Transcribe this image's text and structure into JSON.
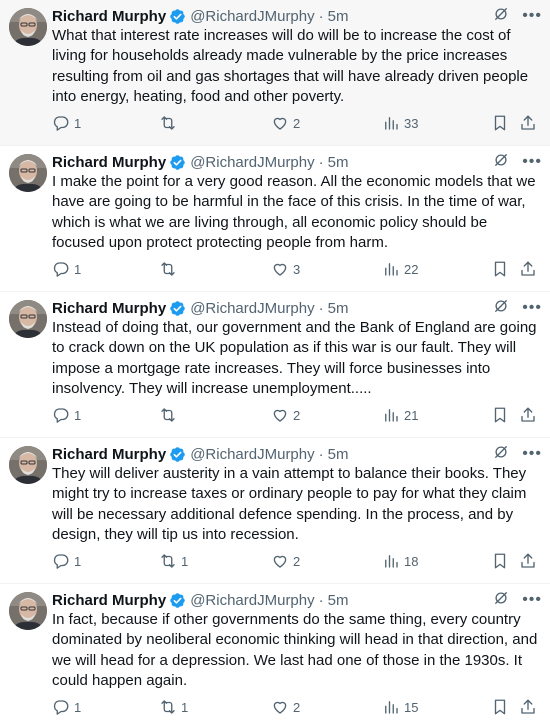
{
  "tweets": [
    {
      "name": "Richard Murphy",
      "handle": "@RichardJMurphy",
      "sep": "·",
      "time": "5m",
      "text": "What that interest rate increases will do will be to increase the cost of living for households already made vulnerable by the price increases resulting from oil and gas shortages that will have already driven people into energy, heating, food and other poverty.",
      "replies": "1",
      "retweets": "",
      "likes": "2",
      "views": "33"
    },
    {
      "name": "Richard Murphy",
      "handle": "@RichardJMurphy",
      "sep": "·",
      "time": "5m",
      "text": "I make the point for a very good reason. All the economic models that we have are going to be harmful in the face of this crisis. In the time of war, which is what we are living through, all economic policy should be focused upon protect protecting people from harm.",
      "replies": "1",
      "retweets": "",
      "likes": "3",
      "views": "22"
    },
    {
      "name": "Richard Murphy",
      "handle": "@RichardJMurphy",
      "sep": "·",
      "time": "5m",
      "text": "Instead of doing that, our government and the Bank of England are going to crack down on the UK population as if this war is our fault. They will impose a mortgage rate increases. They will force businesses into insolvency. They will increase unemployment.....",
      "replies": "1",
      "retweets": "",
      "likes": "2",
      "views": "21"
    },
    {
      "name": "Richard Murphy",
      "handle": "@RichardJMurphy",
      "sep": "·",
      "time": "5m",
      "text": "They will deliver austerity in a vain attempt to balance their books. They might try to increase taxes or ordinary people to pay for what they claim will be necessary additional defence spending. In the process, and by design, they will tip us into recession.",
      "replies": "1",
      "retweets": "1",
      "likes": "2",
      "views": "18"
    },
    {
      "name": "Richard Murphy",
      "handle": "@RichardJMurphy",
      "sep": "·",
      "time": "5m",
      "text": "In fact, because if other governments do the same thing, every country dominated by neoliberal economic thinking will head in that direction, and we will head for a depression. We last had one of those in the 1930s. It could happen again.",
      "replies": "1",
      "retweets": "1",
      "likes": "2",
      "views": "15"
    }
  ],
  "icons": {
    "verified": "verified-badge-icon",
    "grok": "grok-icon",
    "more": "more-icon",
    "reply": "reply-icon",
    "retweet": "retweet-icon",
    "like": "heart-icon",
    "views": "views-icon",
    "bookmark": "bookmark-icon",
    "share": "share-icon"
  },
  "colors": {
    "accent": "#1d9bf0",
    "text": "#0f1419",
    "secondary": "#536471",
    "highlight_bg": "#f7f7f7"
  }
}
